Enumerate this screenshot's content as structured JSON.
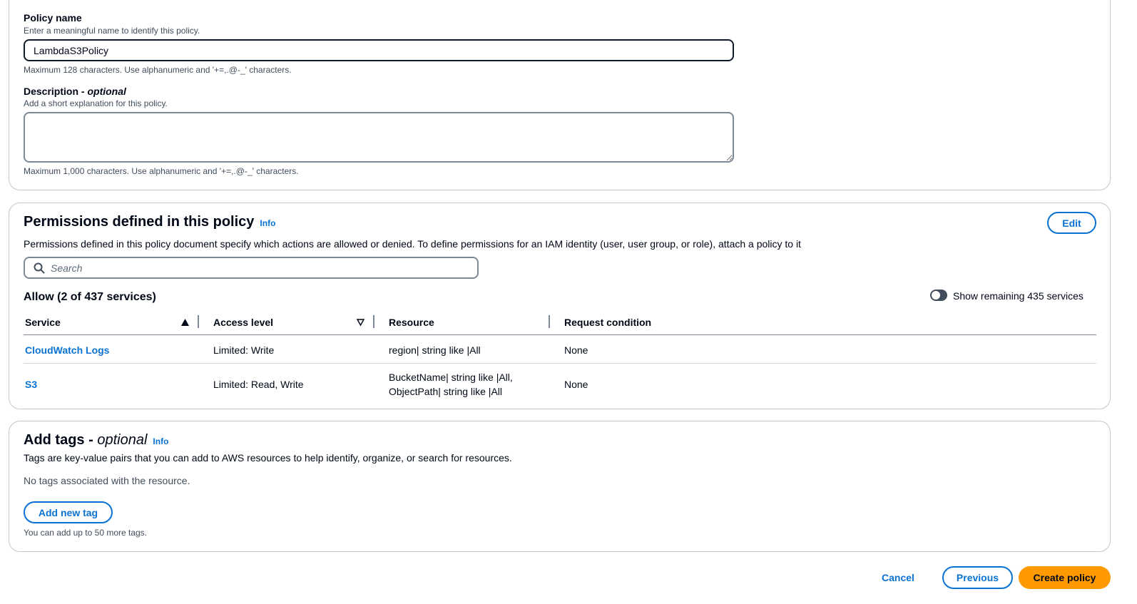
{
  "details": {
    "policy_name_label": "Policy name",
    "policy_name_desc": "Enter a meaningful name to identify this policy.",
    "policy_name_value": "LambdaS3Policy",
    "policy_name_hint": "Maximum 128 characters. Use alphanumeric and '+=,.@-_' characters.",
    "description_label": "Description - ",
    "description_optional": "optional",
    "description_desc": "Add a short explanation for this policy.",
    "description_value": "",
    "description_hint": "Maximum 1,000 characters. Use alphanumeric and '+=,.@-_' characters."
  },
  "permissions": {
    "title": "Permissions defined in this policy",
    "info": "Info",
    "edit_label": "Edit",
    "description": "Permissions defined in this policy document specify which actions are allowed or denied. To define permissions for an IAM identity (user, user group, or role), attach a policy to it",
    "search_placeholder": "Search",
    "allow_heading": "Allow (2 of 437 services)",
    "toggle_label": "Show remaining 435 services",
    "columns": [
      "Service",
      "Access level",
      "Resource",
      "Request condition"
    ],
    "rows": [
      {
        "service": "CloudWatch Logs",
        "access_level": "Limited: Write",
        "resource": "region| string like |All",
        "resource_line2": "",
        "request_condition": "None"
      },
      {
        "service": "S3",
        "access_level": "Limited: Read, Write",
        "resource": "BucketName| string like |All,",
        "resource_line2": "ObjectPath| string like |All",
        "request_condition": "None"
      }
    ]
  },
  "tags": {
    "title": "Add tags - ",
    "title_optional": "optional",
    "info": "Info",
    "description": "Tags are key-value pairs that you can add to AWS resources to help identify, organize, or search for resources.",
    "empty_text": "No tags associated with the resource.",
    "add_label": "Add new tag",
    "hint": "You can add up to 50 more tags."
  },
  "footer": {
    "cancel_label": "Cancel",
    "previous_label": "Previous",
    "create_label": "Create policy"
  },
  "colors": {
    "link": "#0972d3",
    "primary": "#ff9900",
    "border": "#c6c6cd"
  }
}
